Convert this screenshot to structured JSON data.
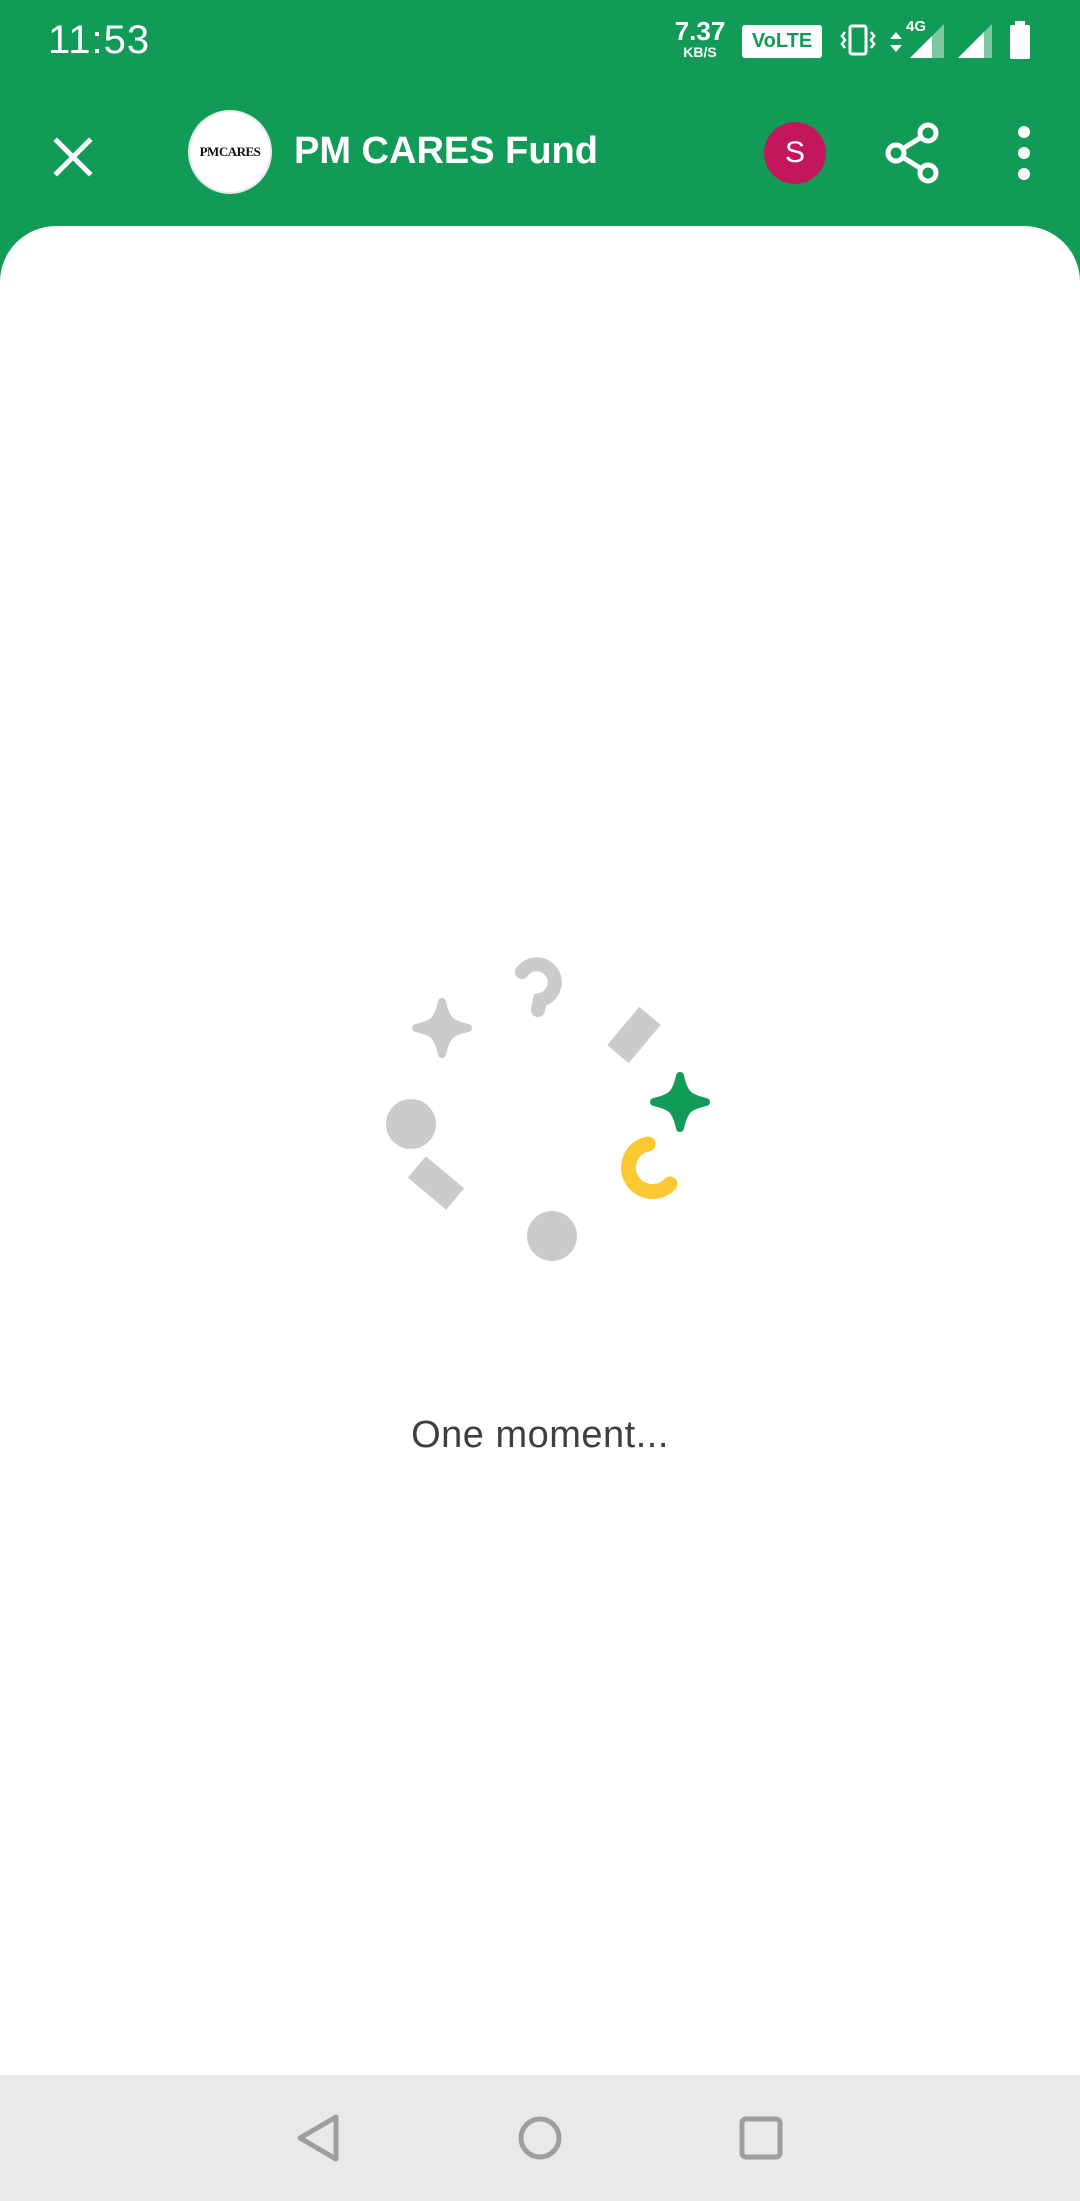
{
  "status_bar": {
    "time": "11:53",
    "net_speed_value": "7.37",
    "net_speed_unit": "KB/S",
    "volte_label": "VoLTE",
    "network_type": "4G",
    "icons": [
      "vibrate-icon",
      "data-arrows-icon",
      "signal-icon",
      "battery-icon"
    ]
  },
  "app_bar": {
    "logo_text": "PMCARES",
    "title": "PM CARES Fund",
    "user_initial": "S",
    "icons": [
      "close-icon",
      "share-icon",
      "more-vert-icon"
    ]
  },
  "content": {
    "loading_text": "One moment..."
  },
  "colors": {
    "brand_green": "#129b56",
    "avatar_pink": "#c2185b",
    "spinner_gray": "#cacbcd",
    "spinner_yellow": "#fcc934",
    "text_dark": "#3c4043"
  },
  "nav_bar": {
    "icons": [
      "back-icon",
      "home-icon",
      "recents-icon"
    ]
  }
}
